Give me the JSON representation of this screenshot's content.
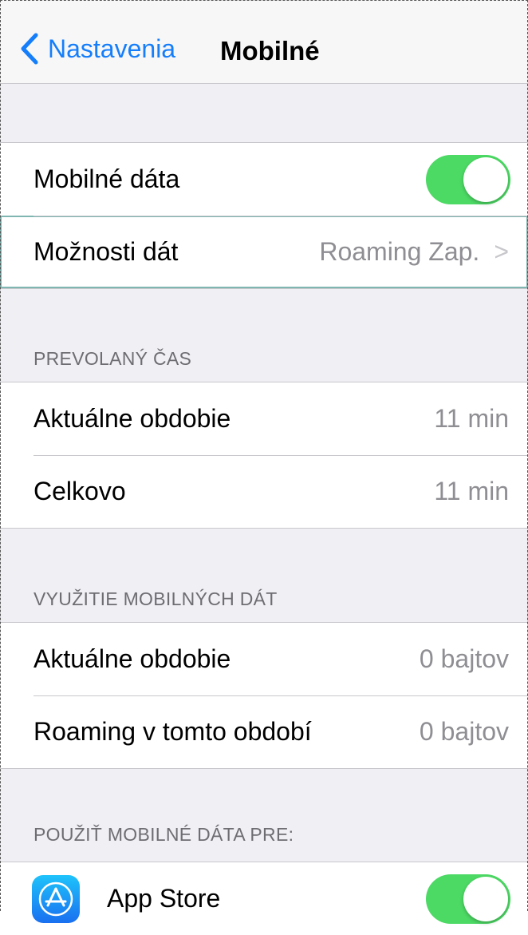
{
  "nav": {
    "back_label": "Nastavenia",
    "title": "Mobilné"
  },
  "mobile_data": {
    "label": "Mobilné dáta",
    "enabled": true
  },
  "data_options": {
    "label": "Možnosti dát",
    "value": "Roaming Zap.",
    "chevron": ">"
  },
  "call_time": {
    "header": "PREVOLANÝ ČAS",
    "rows": [
      {
        "label": "Aktuálne obdobie",
        "value": "11 min"
      },
      {
        "label": "Celkovo",
        "value": "11 min"
      }
    ]
  },
  "data_usage": {
    "header": "VYUŽITIE MOBILNÝCH DÁT",
    "rows": [
      {
        "label": "Aktuálne obdobie",
        "value": "0 bajtov"
      },
      {
        "label": "Roaming v tomto období",
        "value": "0 bajtov"
      }
    ]
  },
  "use_for": {
    "header": "POUŽIŤ MOBILNÉ DÁTA PRE:",
    "apps": [
      {
        "label": "App Store",
        "icon": "app-store-icon",
        "enabled": true
      }
    ]
  },
  "colors": {
    "accent": "#157efb",
    "toggle_on": "#4cd964",
    "background": "#efeff4"
  }
}
